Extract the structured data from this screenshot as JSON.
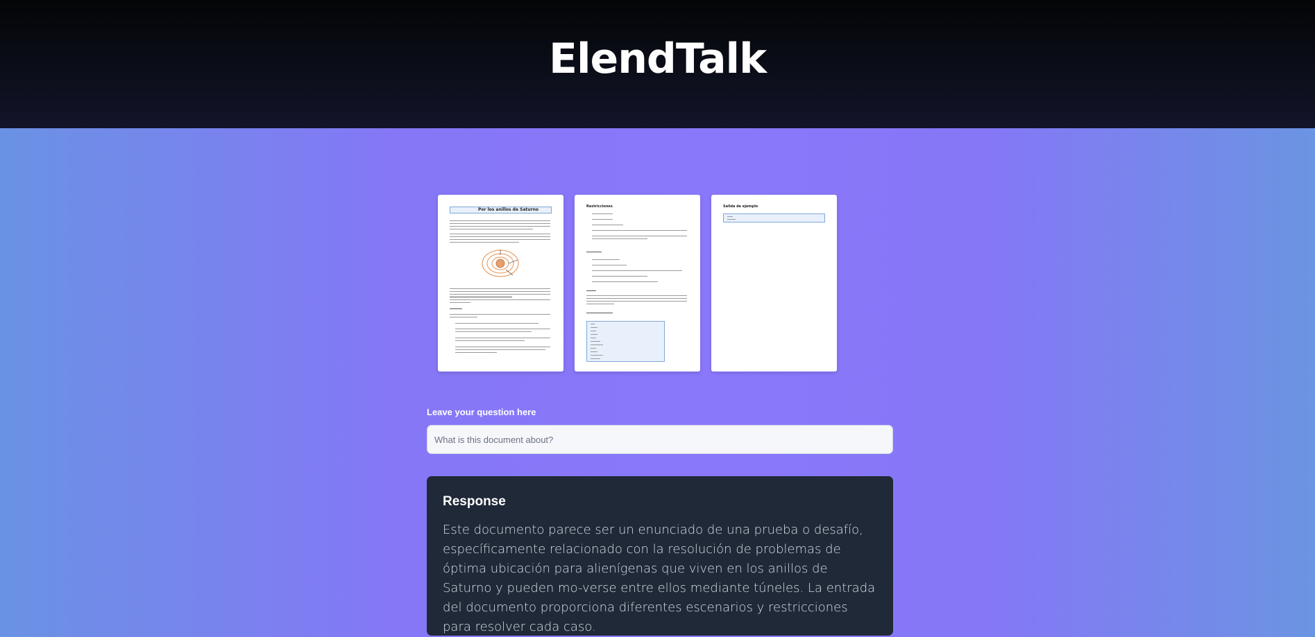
{
  "app": {
    "title": "ElendTalk"
  },
  "pages": [
    {
      "title": "Por los anillos de Saturno",
      "kind": "document-page"
    },
    {
      "title": "Restricciones",
      "kind": "document-page"
    },
    {
      "title": "Salida de ejemplo",
      "kind": "document-page"
    }
  ],
  "question": {
    "label": "Leave your question here",
    "placeholder": "What is this document about?",
    "value": ""
  },
  "response": {
    "heading": "Response",
    "text": "Este documento parece ser un enunciado de una prueba o desafío, específicamente relacionado con la resolución de problemas de óptima ubicación para alienígenas que viven en los anillos de Saturno y pueden mo-verse entre ellos mediante túneles. La entrada del documento proporciona diferentes escenarios y restricciones para resolver cada caso."
  }
}
